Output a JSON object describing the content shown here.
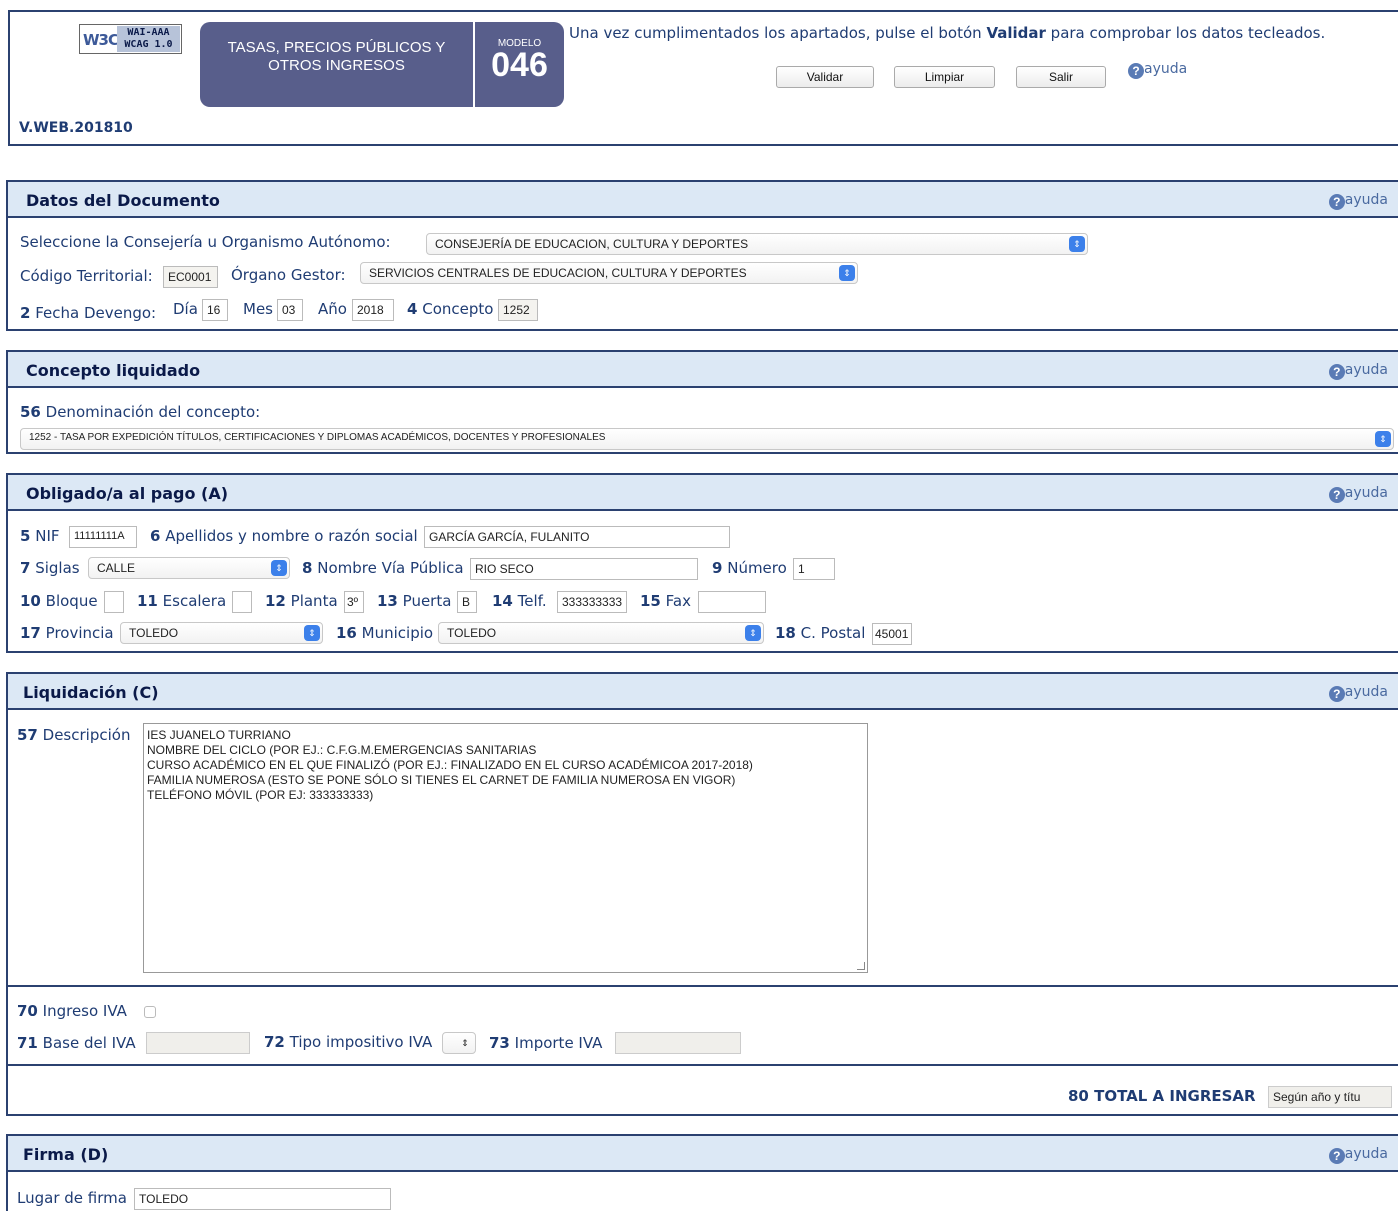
{
  "header": {
    "w3c_logo": "W3C",
    "wai_badge_line1": "WAI-AAA",
    "wai_badge_line2": "WCAG 1.0",
    "title_line1": "TASAS, PRECIOS PÚBLICOS Y",
    "title_line2": "OTROS INGRESOS",
    "modelo_label": "MODELO",
    "modelo_number": "046",
    "instruction_pre": "Una vez cumplimentados los apartados, pulse el botón ",
    "instruction_bold": "Validar",
    "instruction_post": " para comprobar los datos tecleados.",
    "buttons": {
      "validar": "Validar",
      "limpiar": "Limpiar",
      "salir": "Salir"
    },
    "help_label": "ayuda",
    "version": "V.WEB.201810"
  },
  "icons": {
    "help": "question-circle-icon",
    "select_arrow": "select-arrows-icon",
    "resize": "resize-grip-icon"
  },
  "colors": {
    "accent": "#2b4170",
    "header_bg": "#dce8f5",
    "title_box": "#585e8b",
    "select_arrow": "#3c80ea"
  },
  "datos_documento": {
    "title": "Datos del Documento",
    "help": "ayuda",
    "consejeria_label": "Seleccione la Consejería u Organismo Autónomo:",
    "consejeria_value": "CONSEJERÍA DE EDUCACION, CULTURA Y DEPORTES",
    "codigo_label": "Código Territorial:",
    "codigo_value": "EC0001",
    "organo_label": "Órgano Gestor:",
    "organo_value": "SERVICIOS CENTRALES DE EDUCACION, CULTURA Y DEPORTES",
    "fecha_num": "2",
    "fecha_label": "Fecha Devengo:",
    "dia_label": "Día",
    "dia_value": "16",
    "mes_label": "Mes",
    "mes_value": "03",
    "anio_label": "Año",
    "anio_value": "2018",
    "concepto_num": "4",
    "concepto_label": "Concepto",
    "concepto_value": "1252"
  },
  "concepto_liquidado": {
    "title": "Concepto liquidado",
    "help": "ayuda",
    "denominacion_num": "56",
    "denominacion_label": "Denominación del concepto:",
    "denominacion_value": "1252 - TASA POR EXPEDICIÓN TÍTULOS, CERTIFICACIONES Y DIPLOMAS ACADÉMICOS, DOCENTES Y PROFESIONALES"
  },
  "obligado": {
    "title": "Obligado/a al pago (A)",
    "help": "ayuda",
    "nif_num": "5",
    "nif_label": "NIF",
    "nif_value": "11111111A",
    "apellidos_num": "6",
    "apellidos_label": "Apellidos y nombre o razón social",
    "apellidos_value": "GARCÍA GARCÍA, FULANITO",
    "siglas_num": "7",
    "siglas_label": "Siglas",
    "siglas_value": "CALLE",
    "via_num": "8",
    "via_label": "Nombre Vía Pública",
    "via_value": "RIO SECO",
    "numero_num": "9",
    "numero_label": "Número",
    "numero_value": "1",
    "bloque_num": "10",
    "bloque_label": "Bloque",
    "bloque_value": "",
    "escalera_num": "11",
    "escalera_label": "Escalera",
    "escalera_value": "",
    "planta_num": "12",
    "planta_label": "Planta",
    "planta_value": "3º",
    "puerta_num": "13",
    "puerta_label": "Puerta",
    "puerta_value": "B",
    "telf_num": "14",
    "telf_label": "Telf.",
    "telf_value": "333333333",
    "fax_num": "15",
    "fax_label": "Fax",
    "fax_value": "",
    "provincia_num": "17",
    "provincia_label": "Provincia",
    "provincia_value": "TOLEDO",
    "municipio_num": "16",
    "municipio_label": "Municipio",
    "municipio_value": "TOLEDO",
    "cpostal_num": "18",
    "cpostal_label": "C. Postal",
    "cpostal_value": "45001"
  },
  "liquidacion": {
    "title": "Liquidación (C)",
    "help": "ayuda",
    "descripcion_num": "57",
    "descripcion_label": "Descripción",
    "descripcion_value": "IES JUANELO TURRIANO\nNOMBRE DEL CICLO (POR EJ.: C.F.G.M.EMERGENCIAS SANITARIAS\nCURSO ACADÉMICO EN EL QUE FINALIZÓ (POR EJ.: FINALIZADO EN EL CURSO ACADÉMICOA 2017-2018)\nFAMILIA NUMEROSA (ESTO SE PONE SÓLO SI TIENES EL CARNET DE FAMILIA NUMEROSA EN VIGOR)\nTELÉFONO MÓVIL (POR EJ: 333333333)",
    "ingreso_iva_num": "70",
    "ingreso_iva_label": "Ingreso IVA",
    "ingreso_iva_checked": false,
    "base_iva_num": "71",
    "base_iva_label": "Base del IVA",
    "base_iva_value": "",
    "tipo_iva_num": "72",
    "tipo_iva_label": "Tipo impositivo IVA",
    "tipo_iva_value": "",
    "importe_iva_num": "73",
    "importe_iva_label": "Importe IVA",
    "importe_iva_value": "",
    "total_num": "80",
    "total_label": "TOTAL A INGRESAR",
    "total_value": "Según año y títu"
  },
  "firma": {
    "title": "Firma (D)",
    "help": "ayuda",
    "lugar_label": "Lugar de firma",
    "lugar_value": "TOLEDO"
  }
}
